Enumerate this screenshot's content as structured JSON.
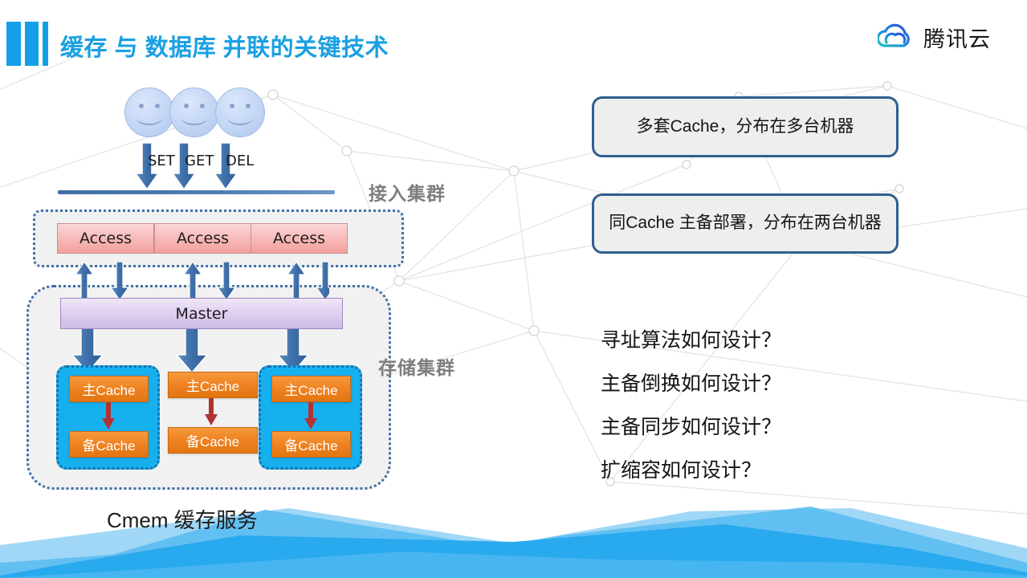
{
  "header": {
    "title": "缓存 与 数据库  并联的关键技术",
    "accent_color": "#13a0e8",
    "title_color": "#1aa0e2",
    "brand_name": "腾讯云",
    "brand_icon": "cloud-icon"
  },
  "diagram": {
    "clients": [
      {
        "icon": "smiley-face-icon"
      },
      {
        "icon": "smiley-face-icon"
      },
      {
        "icon": "smiley-face-icon"
      }
    ],
    "operations": [
      "SET",
      "GET",
      "DEL"
    ],
    "cluster_labels": {
      "access": "接入集群",
      "storage": "存储集群"
    },
    "access_nodes": [
      "Access",
      "Access",
      "Access"
    ],
    "master_label": "Master",
    "cache_groups": [
      {
        "primary": "主Cache",
        "backup": "备Cache",
        "highlighted": true
      },
      {
        "primary": "主Cache",
        "backup": "备Cache",
        "highlighted": false
      },
      {
        "primary": "主Cache",
        "backup": "备Cache",
        "highlighted": true
      }
    ],
    "caption": "Cmem 缓存服务",
    "colors": {
      "access_box": "#f7bcba",
      "master_box": "#ddcdef",
      "cache_box": "#ef8222",
      "group_highlight": "#17b0ef",
      "arrow_blue": "#3f6fa8",
      "sync_arrow_red": "#b33232",
      "cluster_label": "#7e7e7e"
    }
  },
  "callouts": [
    {
      "text": "多套Cache，分布在多台机器"
    },
    {
      "text": "同Cache 主备部署，分布在两台机器"
    }
  ],
  "questions": [
    {
      "text": "寻址算法如何设计？"
    },
    {
      "text": "主备倒换如何设计？"
    },
    {
      "text": "主备同步如何设计？"
    },
    {
      "text": "扩缩容如何设计？"
    }
  ]
}
